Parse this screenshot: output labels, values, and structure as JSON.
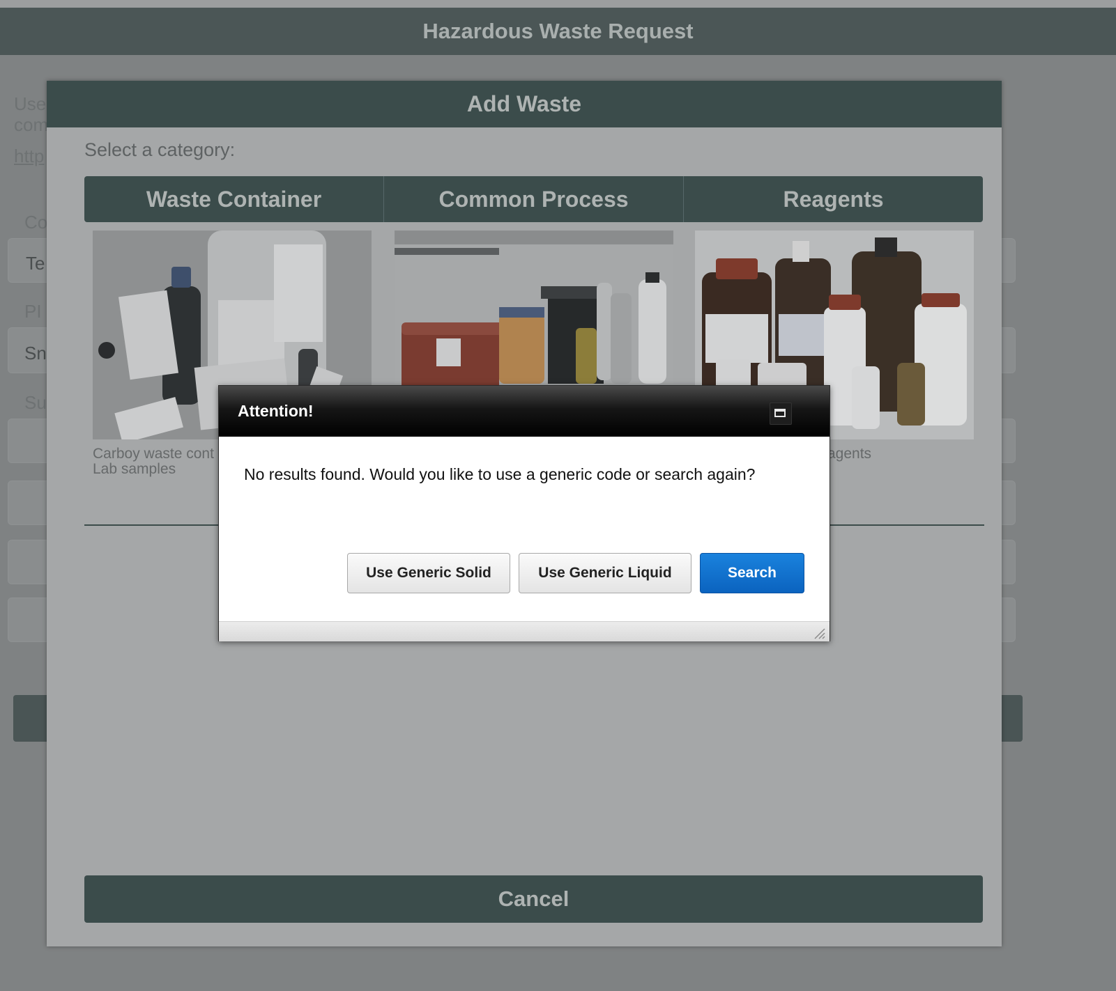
{
  "app": {
    "title": "Hazardous Waste Request"
  },
  "background": {
    "intro_line1": "Use",
    "intro_line2": "com",
    "link": "http",
    "contact_label": "Co",
    "contact_value": "Te",
    "pi_label": "PI",
    "pi_value": "Sn",
    "sub_label": "Su"
  },
  "modal": {
    "title": "Add Waste",
    "select_label": "Select a category:",
    "categories": [
      {
        "label": "Waste Container",
        "caption_line1": "Carboy waste cont",
        "caption_line2": "Lab samples"
      },
      {
        "label": "Common Process",
        "caption_line1": "",
        "caption_line2": ""
      },
      {
        "label": "Reagents",
        "caption_line1": "agents",
        "caption_line2": ""
      }
    ],
    "cancel_label": "Cancel"
  },
  "dialog": {
    "title": "Attention!",
    "message": "No results found. Would you like to use a generic code or search again?",
    "buttons": {
      "generic_solid": "Use Generic Solid",
      "generic_liquid": "Use Generic Liquid",
      "search": "Search"
    },
    "icons": {
      "maximize": "maximize-icon",
      "resize": "resize-grip-icon"
    }
  },
  "colors": {
    "header": "#4b5656",
    "modal_header": "#3b4c4b",
    "primary_button": "#0b63bf"
  }
}
